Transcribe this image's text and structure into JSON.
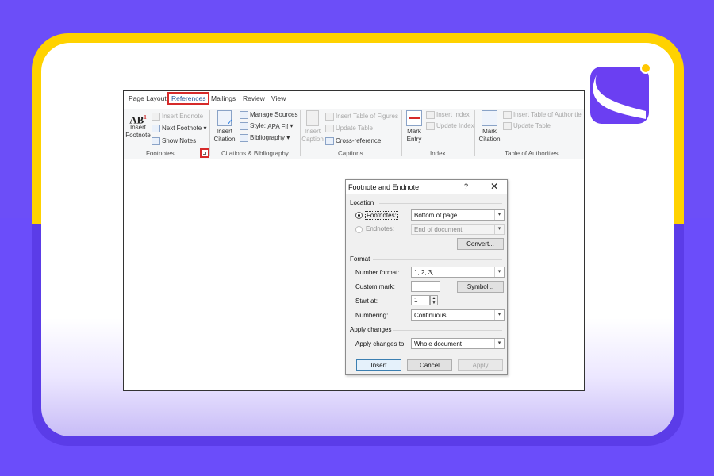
{
  "colors": {
    "purple": "#6b4dfa",
    "yellow": "#ffd200",
    "ribbon_highlight": "#d62a2a"
  },
  "tabs": [
    "Page Layout",
    "References",
    "Mailings",
    "Review",
    "View"
  ],
  "ribbon": {
    "footnotes": {
      "insert_footnote": "Insert Footnote",
      "insert_endnote": "Insert Endnote",
      "next_footnote": "Next Footnote",
      "show_notes": "Show Notes",
      "group": "Footnotes",
      "icon_text": "AB",
      "icon_sup": "1"
    },
    "citations": {
      "insert_citation": "Insert Citation",
      "manage_sources": "Manage Sources",
      "style_label": "Style:",
      "style_value": "APA Fifth",
      "bibliography": "Bibliography",
      "group": "Citations & Bibliography"
    },
    "captions": {
      "insert_caption": "Insert Caption",
      "insert_table_of_figures": "Insert Table of Figures",
      "update_table": "Update Table",
      "cross_reference": "Cross-reference",
      "group": "Captions"
    },
    "index": {
      "mark_entry": "Mark Entry",
      "insert_index": "Insert Index",
      "update_index": "Update Index",
      "group": "Index"
    },
    "authorities": {
      "mark_citation": "Mark Citation",
      "insert_table_of_authorities": "Insert Table of Authorities",
      "update_table": "Update Table",
      "group": "Table of Authorities"
    }
  },
  "dialog": {
    "title": "Footnote and Endnote",
    "help": "?",
    "close": "✕",
    "location": {
      "section": "Location",
      "footnotes_label": "Footnotes:",
      "footnotes_value": "Bottom of page",
      "endnotes_label": "Endnotes:",
      "endnotes_value": "End of document",
      "convert": "Convert..."
    },
    "format": {
      "section": "Format",
      "number_format_label": "Number format:",
      "number_format_value": "1, 2, 3, ...",
      "custom_mark_label": "Custom mark:",
      "custom_mark_value": "",
      "symbol": "Symbol...",
      "start_at_label": "Start at:",
      "start_at_value": "1",
      "numbering_label": "Numbering:",
      "numbering_value": "Continuous"
    },
    "apply": {
      "section": "Apply changes",
      "apply_to_label": "Apply changes to:",
      "apply_to_value": "Whole document"
    },
    "buttons": {
      "insert": "Insert",
      "cancel": "Cancel",
      "apply": "Apply"
    }
  }
}
